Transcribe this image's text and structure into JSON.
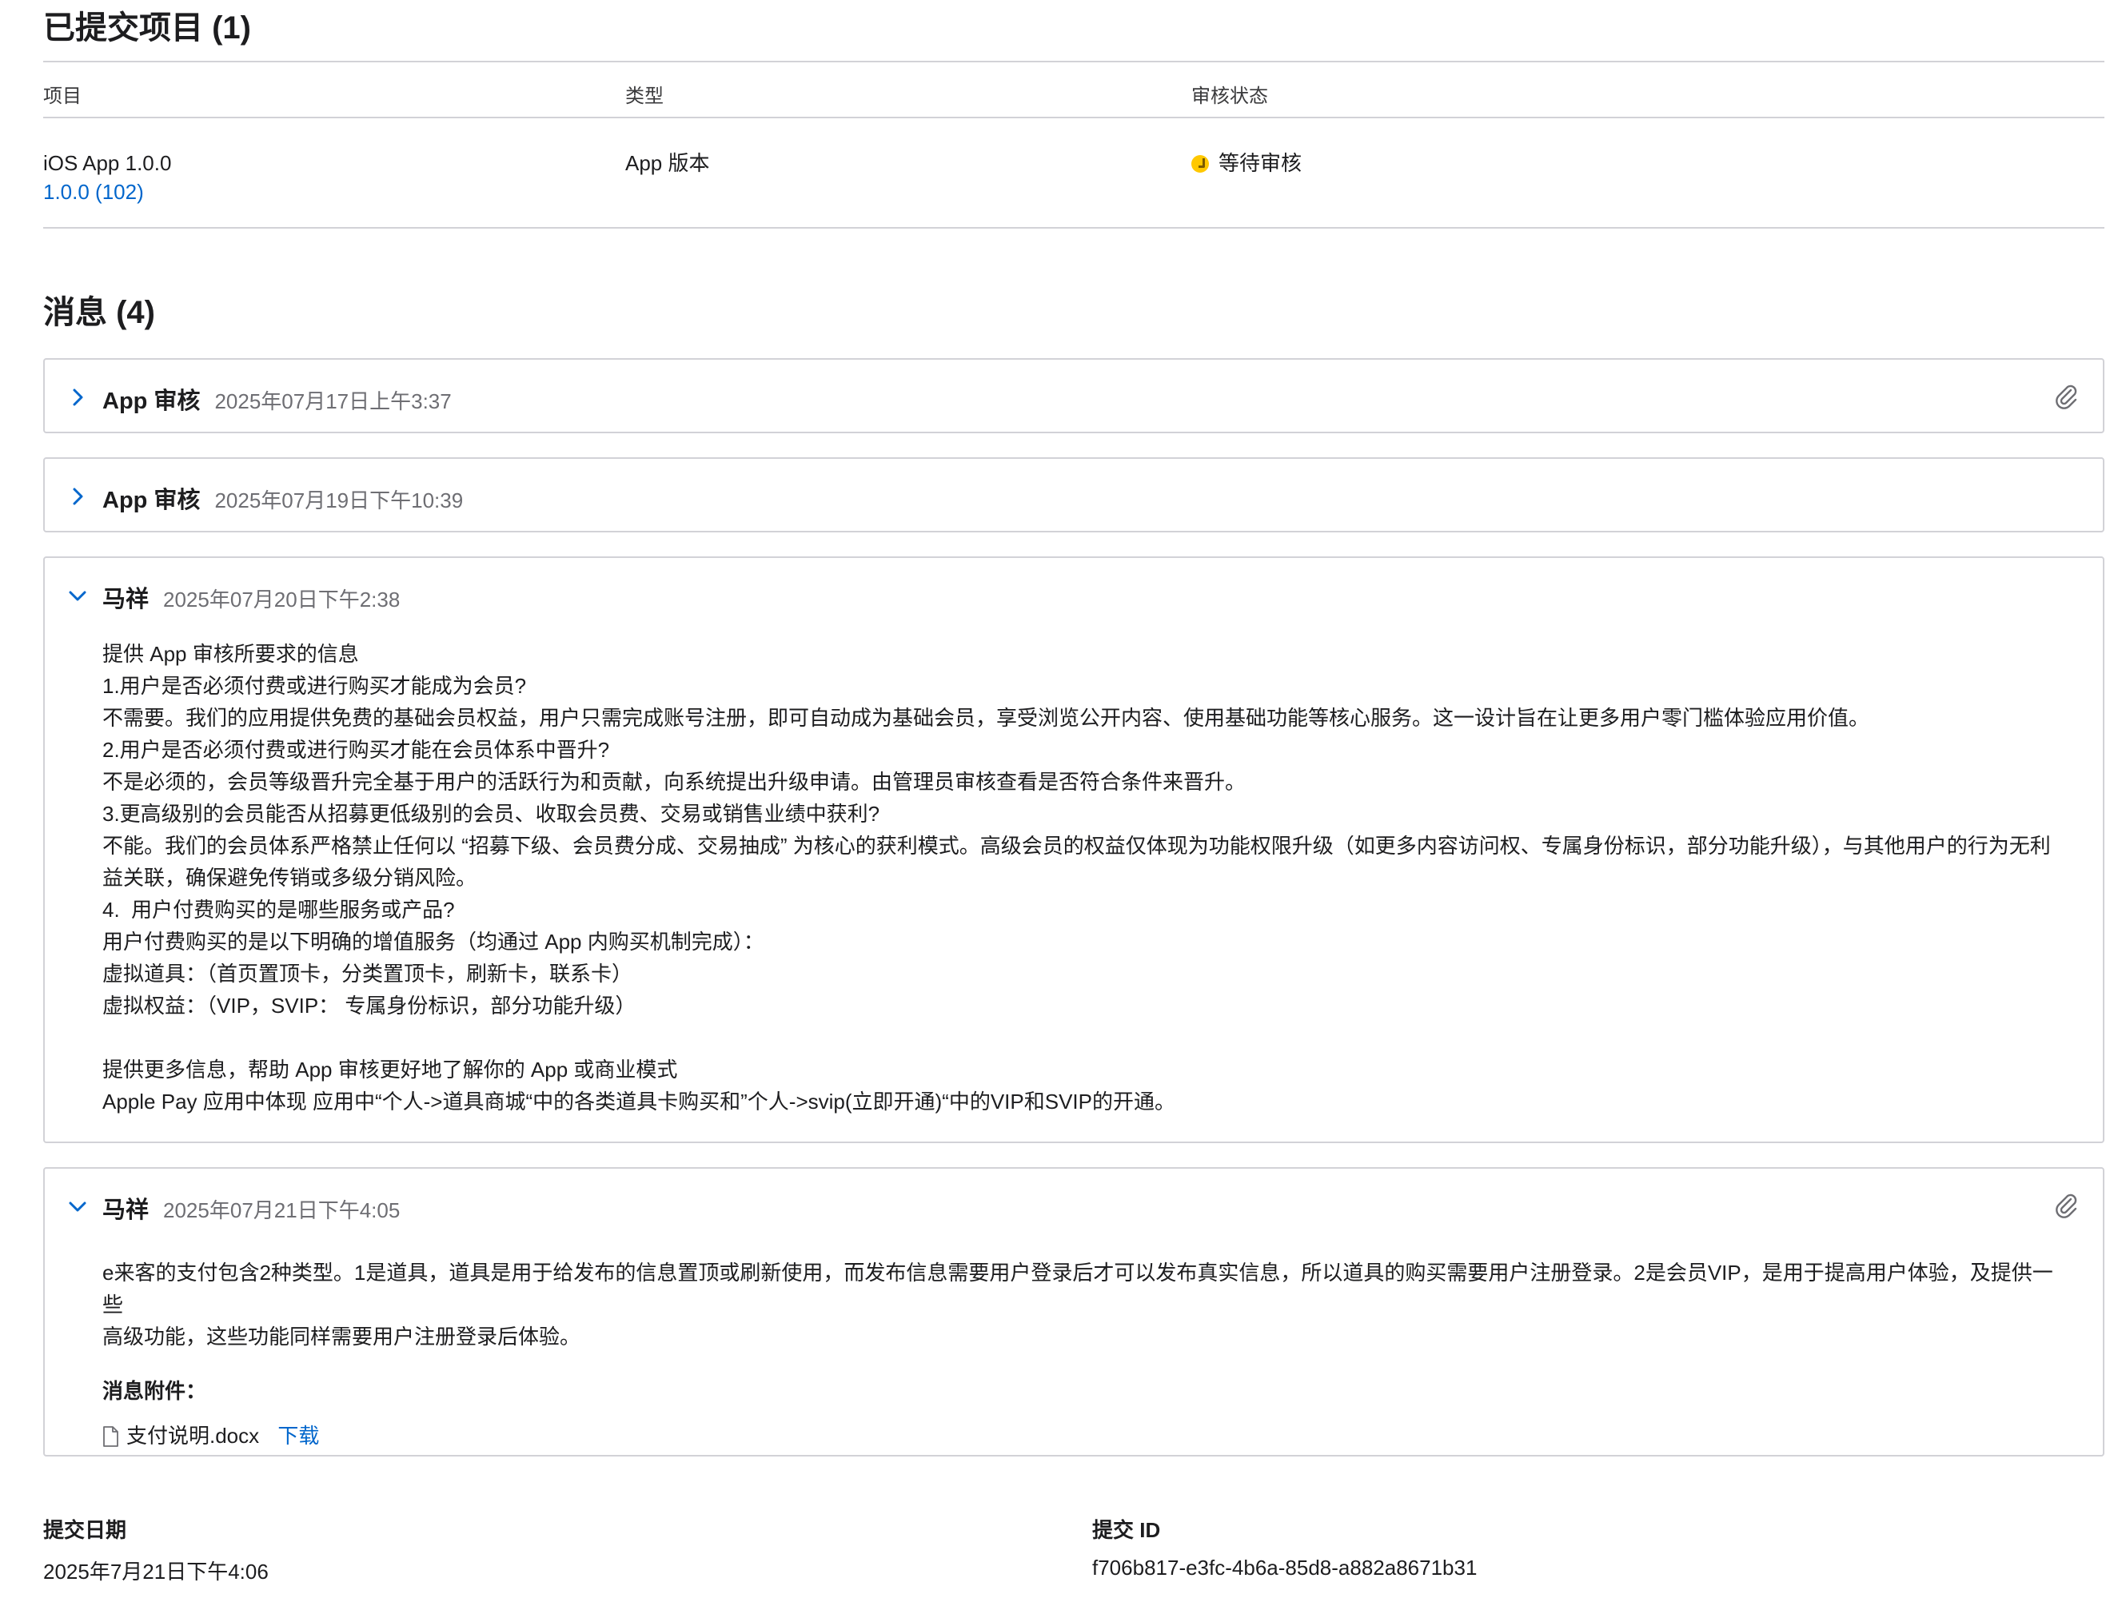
{
  "submitted": {
    "title": "已提交项目 (1)",
    "columns": [
      "项目",
      "类型",
      "审核状态"
    ],
    "row": {
      "item_name": "iOS App 1.0.0",
      "item_build": "1.0.0 (102)",
      "type": "App 版本",
      "status": "等待审核",
      "status_color": "#ffc800"
    }
  },
  "messages": {
    "title": "消息 (4)",
    "items": [
      {
        "author": "App 审核",
        "date": "2025年07月17日上午3:37",
        "expanded": false,
        "has_attachment": true
      },
      {
        "author": "App 审核",
        "date": "2025年07月19日下午10:39",
        "expanded": false,
        "has_attachment": false
      },
      {
        "author": "马祥",
        "date": "2025年07月20日下午2:38",
        "expanded": true,
        "has_attachment": false,
        "lines": [
          "提供 App 审核所要求的信息",
          "1.用户是否必须付费或进行购买才能成为会员?",
          "不需要。我们的应用提供免费的基础会员权益，用户只需完成账号注册，即可自动成为基础会员，享受浏览公开内容、使用基础功能等核心服务。这一设计旨在让更多用户零门槛体验应用价值。",
          "2.用户是否必须付费或进行购买才能在会员体系中晋升?",
          "不是必须的，会员等级晋升完全基于用户的活跃行为和贡献，向系统提出升级申请。由管理员审核查看是否符合条件来晋升。",
          "3.更高级别的会员能否从招募更低级别的会员、收取会员费、交易或销售业绩中获利?",
          "不能。我们的会员体系严格禁止任何以 “招募下级、会员费分成、交易抽成” 为核心的获利模式。高级会员的权益仅体现为功能权限升级（如更多内容访问权、专属身份标识，部分功能升级），与其他用户的行为无利",
          "益关联，确保避免传销或多级分销风险。",
          "4.  用户付费购买的是哪些服务或产品?",
          "用户付费购买的是以下明确的增值服务（均通过 App 内购买机制完成）：",
          "虚拟道具：（首页置顶卡，分类置顶卡，刷新卡，联系卡）",
          "虚拟权益：（VIP，SVIP： 专属身份标识，部分功能升级）",
          "",
          "提供更多信息，帮助 App 审核更好地了解你的 App 或商业模式",
          "Apple Pay 应用中体现 应用中“个人->道具商城“中的各类道具卡购买和”个人->svip(立即开通)“中的VIP和SVIP的开通。"
        ]
      },
      {
        "author": "马祥",
        "date": "2025年07月21日下午4:05",
        "expanded": true,
        "has_attachment": true,
        "lines": [
          "e来客的支付包含2种类型。1是道具，道具是用于给发布的信息置顶或刷新使用，而发布信息需要用户登录后才可以发布真实信息，所以道具的购买需要用户注册登录。2是会员VIP，是用于提高用户体验，及提供一些",
          "高级功能，这些功能同样需要用户注册登录后体验。"
        ],
        "attachments_label": "消息附件：",
        "attachment_file": "支付说明.docx",
        "attachment_action": "下载"
      }
    ]
  },
  "footer": {
    "date_label": "提交日期",
    "date_value": "2025年7月21日下午4:06",
    "id_label": "提交 ID",
    "id_value": "f706b817-e3fc-4b6a-85d8-a882a8671b31"
  },
  "colors": {
    "link": "#0066cc",
    "border": "#d2d2d7",
    "muted": "#6e6e73"
  }
}
